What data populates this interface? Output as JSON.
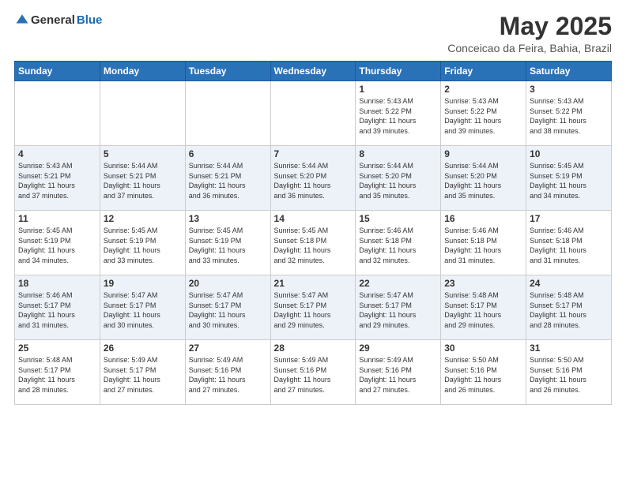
{
  "header": {
    "logo_general": "General",
    "logo_blue": "Blue",
    "month": "May 2025",
    "location": "Conceicao da Feira, Bahia, Brazil"
  },
  "weekdays": [
    "Sunday",
    "Monday",
    "Tuesday",
    "Wednesday",
    "Thursday",
    "Friday",
    "Saturday"
  ],
  "weeks": [
    [
      {
        "day": "",
        "info": ""
      },
      {
        "day": "",
        "info": ""
      },
      {
        "day": "",
        "info": ""
      },
      {
        "day": "",
        "info": ""
      },
      {
        "day": "1",
        "info": "Sunrise: 5:43 AM\nSunset: 5:22 PM\nDaylight: 11 hours\nand 39 minutes."
      },
      {
        "day": "2",
        "info": "Sunrise: 5:43 AM\nSunset: 5:22 PM\nDaylight: 11 hours\nand 39 minutes."
      },
      {
        "day": "3",
        "info": "Sunrise: 5:43 AM\nSunset: 5:22 PM\nDaylight: 11 hours\nand 38 minutes."
      }
    ],
    [
      {
        "day": "4",
        "info": "Sunrise: 5:43 AM\nSunset: 5:21 PM\nDaylight: 11 hours\nand 37 minutes."
      },
      {
        "day": "5",
        "info": "Sunrise: 5:44 AM\nSunset: 5:21 PM\nDaylight: 11 hours\nand 37 minutes."
      },
      {
        "day": "6",
        "info": "Sunrise: 5:44 AM\nSunset: 5:21 PM\nDaylight: 11 hours\nand 36 minutes."
      },
      {
        "day": "7",
        "info": "Sunrise: 5:44 AM\nSunset: 5:20 PM\nDaylight: 11 hours\nand 36 minutes."
      },
      {
        "day": "8",
        "info": "Sunrise: 5:44 AM\nSunset: 5:20 PM\nDaylight: 11 hours\nand 35 minutes."
      },
      {
        "day": "9",
        "info": "Sunrise: 5:44 AM\nSunset: 5:20 PM\nDaylight: 11 hours\nand 35 minutes."
      },
      {
        "day": "10",
        "info": "Sunrise: 5:45 AM\nSunset: 5:19 PM\nDaylight: 11 hours\nand 34 minutes."
      }
    ],
    [
      {
        "day": "11",
        "info": "Sunrise: 5:45 AM\nSunset: 5:19 PM\nDaylight: 11 hours\nand 34 minutes."
      },
      {
        "day": "12",
        "info": "Sunrise: 5:45 AM\nSunset: 5:19 PM\nDaylight: 11 hours\nand 33 minutes."
      },
      {
        "day": "13",
        "info": "Sunrise: 5:45 AM\nSunset: 5:19 PM\nDaylight: 11 hours\nand 33 minutes."
      },
      {
        "day": "14",
        "info": "Sunrise: 5:45 AM\nSunset: 5:18 PM\nDaylight: 11 hours\nand 32 minutes."
      },
      {
        "day": "15",
        "info": "Sunrise: 5:46 AM\nSunset: 5:18 PM\nDaylight: 11 hours\nand 32 minutes."
      },
      {
        "day": "16",
        "info": "Sunrise: 5:46 AM\nSunset: 5:18 PM\nDaylight: 11 hours\nand 31 minutes."
      },
      {
        "day": "17",
        "info": "Sunrise: 5:46 AM\nSunset: 5:18 PM\nDaylight: 11 hours\nand 31 minutes."
      }
    ],
    [
      {
        "day": "18",
        "info": "Sunrise: 5:46 AM\nSunset: 5:17 PM\nDaylight: 11 hours\nand 31 minutes."
      },
      {
        "day": "19",
        "info": "Sunrise: 5:47 AM\nSunset: 5:17 PM\nDaylight: 11 hours\nand 30 minutes."
      },
      {
        "day": "20",
        "info": "Sunrise: 5:47 AM\nSunset: 5:17 PM\nDaylight: 11 hours\nand 30 minutes."
      },
      {
        "day": "21",
        "info": "Sunrise: 5:47 AM\nSunset: 5:17 PM\nDaylight: 11 hours\nand 29 minutes."
      },
      {
        "day": "22",
        "info": "Sunrise: 5:47 AM\nSunset: 5:17 PM\nDaylight: 11 hours\nand 29 minutes."
      },
      {
        "day": "23",
        "info": "Sunrise: 5:48 AM\nSunset: 5:17 PM\nDaylight: 11 hours\nand 29 minutes."
      },
      {
        "day": "24",
        "info": "Sunrise: 5:48 AM\nSunset: 5:17 PM\nDaylight: 11 hours\nand 28 minutes."
      }
    ],
    [
      {
        "day": "25",
        "info": "Sunrise: 5:48 AM\nSunset: 5:17 PM\nDaylight: 11 hours\nand 28 minutes."
      },
      {
        "day": "26",
        "info": "Sunrise: 5:49 AM\nSunset: 5:17 PM\nDaylight: 11 hours\nand 27 minutes."
      },
      {
        "day": "27",
        "info": "Sunrise: 5:49 AM\nSunset: 5:16 PM\nDaylight: 11 hours\nand 27 minutes."
      },
      {
        "day": "28",
        "info": "Sunrise: 5:49 AM\nSunset: 5:16 PM\nDaylight: 11 hours\nand 27 minutes."
      },
      {
        "day": "29",
        "info": "Sunrise: 5:49 AM\nSunset: 5:16 PM\nDaylight: 11 hours\nand 27 minutes."
      },
      {
        "day": "30",
        "info": "Sunrise: 5:50 AM\nSunset: 5:16 PM\nDaylight: 11 hours\nand 26 minutes."
      },
      {
        "day": "31",
        "info": "Sunrise: 5:50 AM\nSunset: 5:16 PM\nDaylight: 11 hours\nand 26 minutes."
      }
    ]
  ]
}
